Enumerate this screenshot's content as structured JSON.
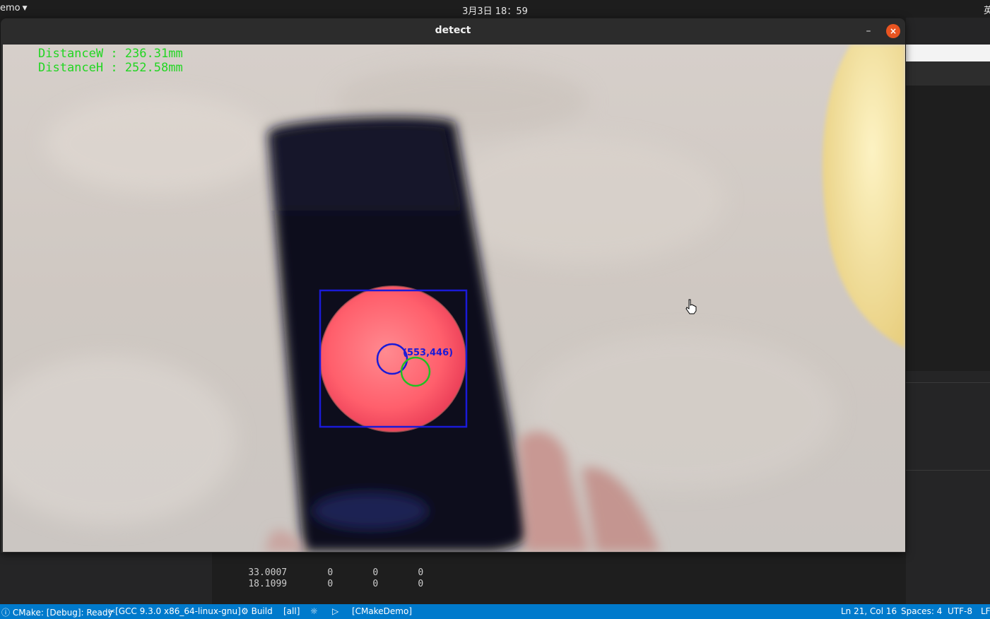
{
  "topbar": {
    "app_menu": "emo",
    "clock": "3月3日  18：59",
    "ime": "英"
  },
  "window": {
    "title": "detect",
    "minimize": "–",
    "close": "×"
  },
  "overlay": {
    "distance_w": "DistanceW : 236.31mm",
    "distance_h": "DistanceH : 252.58mm",
    "center_label": "(553,446)",
    "colors": {
      "measure_text": "#22d622",
      "bbox": "#1a1ad8",
      "circle_blue": "#1a1ad8",
      "circle_green": "#22c022"
    }
  },
  "terminal": {
    "rows": [
      [
        "33.0007",
        "0",
        "0",
        "0"
      ],
      [
        "18.1099",
        "0",
        "0",
        "0"
      ]
    ]
  },
  "statusbar": {
    "cmake_status": "CMake: [Debug]: Ready",
    "kit": "[GCC 9.3.0 x86_64-linux-gnu]",
    "build": "Build",
    "target": "[all]",
    "debug_icon": "bug-icon",
    "run_icon": "play-icon",
    "project": "[CMakeDemo]",
    "position": "Ln 21, Col 16",
    "spaces": "Spaces: 4",
    "encoding": "UTF-8",
    "eol": "LF",
    "accent": "#007acc"
  }
}
